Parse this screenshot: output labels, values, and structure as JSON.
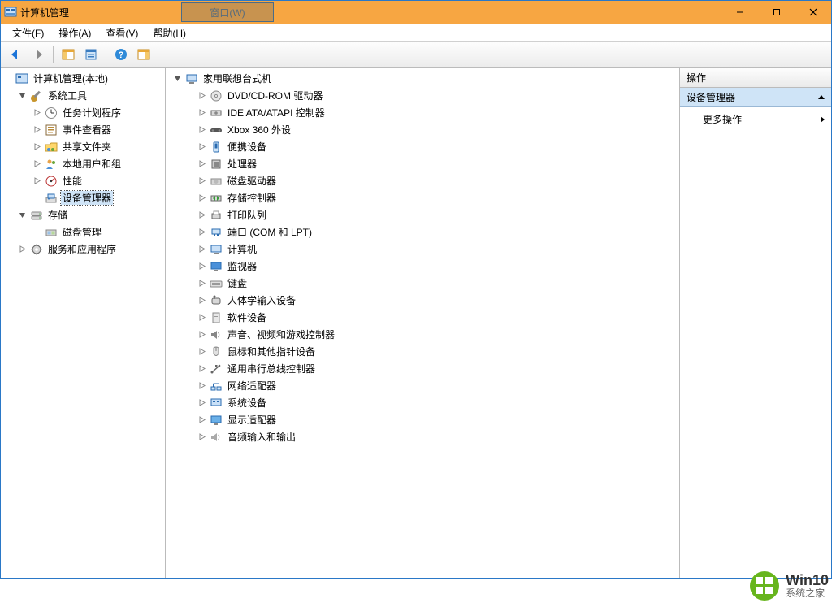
{
  "window": {
    "title": "计算机管理",
    "ghost_menu": "窗口(W)"
  },
  "menu": {
    "file": "文件(F)",
    "action": "操作(A)",
    "view": "查看(V)",
    "help": "帮助(H)"
  },
  "toolbar": {
    "back": "back",
    "forward": "forward",
    "up": "up",
    "show_hide_tree": "show-hide-console-tree",
    "properties": "properties",
    "help": "help",
    "show_hide_action": "show-hide-action-pane"
  },
  "left_tree": {
    "root": "计算机管理(本地)",
    "system_tools": {
      "label": "系统工具",
      "children": {
        "task_scheduler": "任务计划程序",
        "event_viewer": "事件查看器",
        "shared_folders": "共享文件夹",
        "local_users": "本地用户和组",
        "performance": "性能",
        "device_manager": "设备管理器"
      }
    },
    "storage": {
      "label": "存储",
      "children": {
        "disk_management": "磁盘管理"
      }
    },
    "services": "服务和应用程序"
  },
  "center_tree": {
    "root": "家用联想台式机",
    "children": {
      "dvd": "DVD/CD-ROM 驱动器",
      "ide": "IDE ATA/ATAPI 控制器",
      "xbox": "Xbox 360 外设",
      "portable": "便携设备",
      "processors": "处理器",
      "disk_drives": "磁盘驱动器",
      "storage_controllers": "存储控制器",
      "print_queues": "打印队列",
      "ports": "端口 (COM 和 LPT)",
      "computer": "计算机",
      "monitors": "监视器",
      "keyboards": "键盘",
      "hid": "人体学输入设备",
      "software_devices": "软件设备",
      "sound": "声音、视频和游戏控制器",
      "mice": "鼠标和其他指针设备",
      "usb": "通用串行总线控制器",
      "network": "网络适配器",
      "system_devices": "系统设备",
      "display": "显示适配器",
      "audio_io": "音频输入和输出"
    }
  },
  "actions": {
    "header": "操作",
    "section": "设备管理器",
    "more": "更多操作"
  },
  "watermark": {
    "big": "Win10",
    "small": "系统之家"
  }
}
